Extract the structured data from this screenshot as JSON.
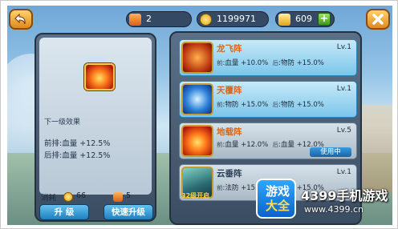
{
  "colors": {
    "accent": "#1f7fbf",
    "selected_row": "#7cc5ea",
    "coin": "#f2b21f",
    "ingot": "#f5c53a"
  },
  "topbar": {
    "back_icon": "back-arrow-icon",
    "close_icon": "close-x-icon",
    "resources": [
      {
        "icon": "feather-token-icon",
        "value": "2"
      },
      {
        "icon": "gold-coin-icon",
        "value": "1199971"
      },
      {
        "icon": "gold-ingot-icon",
        "value": "609"
      }
    ],
    "add_label": "+"
  },
  "detail": {
    "skill_icon": "explosion-skill-icon",
    "next_label": "下一级效果",
    "effects": [
      "前排:血量 +12.5%",
      "后排:血量 +12.5%"
    ],
    "cost_label": "消耗",
    "cost_coin": "66",
    "cost_token": "5",
    "upgrade_label": "升 级",
    "quick_upgrade_label": "快速升级"
  },
  "formations": [
    {
      "name": "龙飞阵",
      "level": "Lv.1",
      "front_key": "前",
      "front": ":血量 +10.0%",
      "back_key": "后",
      "back": ":物防 +15.0%",
      "icon": "dragon-icon",
      "name_color": "#d2691e",
      "selected": true,
      "status": ""
    },
    {
      "name": "天覆阵",
      "level": "Lv.1",
      "front_key": "前",
      "front": ":物防 +15.0%",
      "back_key": "后",
      "back": ":物防 +15.0%",
      "icon": "lightning-icon",
      "name_color": "#d2691e",
      "selected": true,
      "status": ""
    },
    {
      "name": "地载阵",
      "level": "Lv.5",
      "front_key": "前",
      "front": ":血量 +12.0%",
      "back_key": "后",
      "back": ":血量 +12.0%",
      "icon": "explosion-icon",
      "name_color": "#d2691e",
      "selected": false,
      "status": "使用中"
    },
    {
      "name": "云垂阵",
      "level": "Lv.1",
      "front_key": "前",
      "front": ":法防 +15.0%",
      "back_key": "后",
      "back": ":法防 +15.0%",
      "icon": "cloud-icon",
      "name_color": "#2a3c55",
      "selected": false,
      "status": "",
      "unlock": "32级开启"
    }
  ],
  "watermark": {
    "box_line1": "游戏",
    "box_line2": "大全",
    "title": "4399手机游戏",
    "url": "www.4399.cn"
  }
}
